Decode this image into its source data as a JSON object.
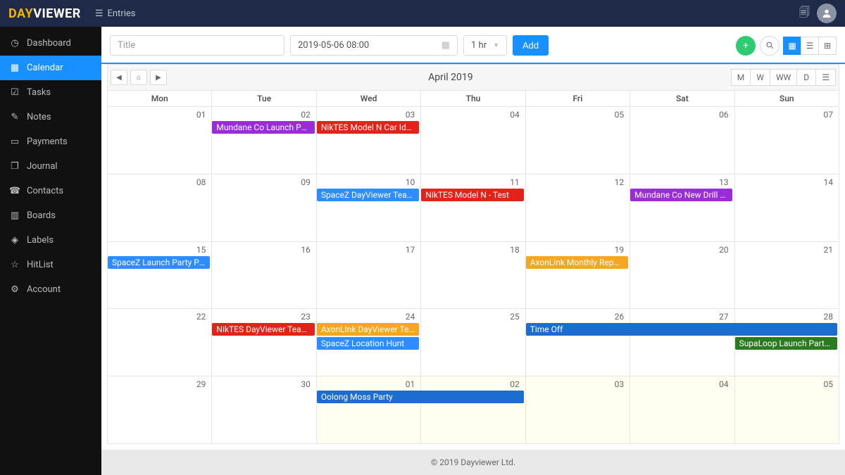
{
  "header": {
    "logo_day": "DAY",
    "logo_viewer": "VIEWER",
    "entries_label": "Entries"
  },
  "sidebar": {
    "items": [
      {
        "label": "Dashboard",
        "icon": "dashboard"
      },
      {
        "label": "Calendar",
        "icon": "calendar",
        "active": true
      },
      {
        "label": "Tasks",
        "icon": "tasks"
      },
      {
        "label": "Notes",
        "icon": "notes"
      },
      {
        "label": "Payments",
        "icon": "payments"
      },
      {
        "label": "Journal",
        "icon": "journal"
      },
      {
        "label": "Contacts",
        "icon": "contacts"
      },
      {
        "label": "Boards",
        "icon": "boards"
      },
      {
        "label": "Labels",
        "icon": "labels"
      },
      {
        "label": "HitList",
        "icon": "hitlist"
      },
      {
        "label": "Account",
        "icon": "account"
      }
    ]
  },
  "toolbar": {
    "title_placeholder": "Title",
    "date_value": "2019-05-06 08:00",
    "duration_value": "1 hr",
    "add_label": "Add"
  },
  "calendar": {
    "title": "April 2019",
    "range_buttons": [
      "M",
      "W",
      "WW",
      "D"
    ],
    "day_headers": [
      "Mon",
      "Tue",
      "Wed",
      "Thu",
      "Fri",
      "Sat",
      "Sun"
    ],
    "weeks": [
      [
        "01",
        "02",
        "03",
        "04",
        "05",
        "06",
        "07"
      ],
      [
        "08",
        "09",
        "10",
        "11",
        "12",
        "13",
        "14"
      ],
      [
        "15",
        "16",
        "17",
        "18",
        "19",
        "20",
        "21"
      ],
      [
        "22",
        "23",
        "24",
        "25",
        "26",
        "27",
        "28"
      ],
      [
        "29",
        "30",
        "01",
        "02",
        "03",
        "04",
        "05"
      ]
    ],
    "other_month": [
      [
        4,
        2
      ],
      [
        4,
        3
      ],
      [
        4,
        4
      ],
      [
        4,
        5
      ],
      [
        4,
        6
      ]
    ]
  },
  "events": [
    {
      "week": 0,
      "colStart": 1,
      "colSpan": 1,
      "row": 0,
      "label": "Mundane Co Launch Party …",
      "color": "#9b2dd8"
    },
    {
      "week": 0,
      "colStart": 2,
      "colSpan": 1,
      "row": 0,
      "label": "NikTES Model N Car Ideas",
      "color": "#e2231a"
    },
    {
      "week": 1,
      "colStart": 2,
      "colSpan": 1,
      "row": 0,
      "label": "SpaceZ DayViewer Team Ro…",
      "color": "#2d8cff"
    },
    {
      "week": 1,
      "colStart": 3,
      "colSpan": 1,
      "row": 0,
      "label": "NikTES Model N - Test",
      "color": "#e2231a"
    },
    {
      "week": 1,
      "colStart": 5,
      "colSpan": 1,
      "row": 0,
      "label": "Mundane Co New Drill Bit",
      "color": "#9b2dd8"
    },
    {
      "week": 2,
      "colStart": 0,
      "colSpan": 1,
      "row": 0,
      "label": "SpaceZ Launch Party Paym…",
      "color": "#2d8cff"
    },
    {
      "week": 2,
      "colStart": 4,
      "colSpan": 1,
      "row": 0,
      "label": "AxonLink Monthly Report",
      "color": "#f5a623"
    },
    {
      "week": 3,
      "colStart": 1,
      "colSpan": 1,
      "row": 0,
      "label": "NikTES DayViewer Team Room",
      "color": "#e2231a"
    },
    {
      "week": 3,
      "colStart": 2,
      "colSpan": 1,
      "row": 0,
      "label": "AxonLInk DayViewer Team …",
      "color": "#f5a623"
    },
    {
      "week": 3,
      "colStart": 2,
      "colSpan": 1,
      "row": 1,
      "label": "SpaceZ Location Hunt",
      "color": "#2d8cff"
    },
    {
      "week": 3,
      "colStart": 4,
      "colSpan": 3,
      "row": 0,
      "label": "Time Off",
      "color": "#1c6dd0"
    },
    {
      "week": 3,
      "colStart": 6,
      "colSpan": 1,
      "row": 1,
      "label": "SupaLoop Launch Party Pa…",
      "color": "#2a7a1f"
    },
    {
      "week": 4,
      "colStart": 2,
      "colSpan": 2,
      "row": 0,
      "label": "Oolong Moss Party",
      "color": "#1c6dd0"
    }
  ],
  "footer": {
    "text": "© 2019 Dayviewer Ltd."
  }
}
